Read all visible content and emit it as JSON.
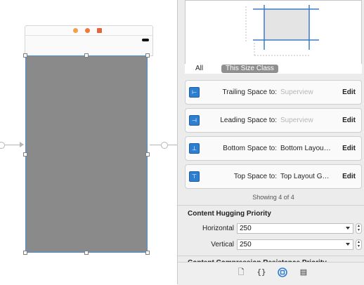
{
  "canvas": {
    "scene_dock_icons": [
      "view-controller-icon",
      "first-responder-icon",
      "exit-icon"
    ],
    "colors": {
      "view_fill": "#8a8a8a",
      "selection": "#4a90d9"
    }
  },
  "inspector": {
    "size_class_tabs": {
      "all": "All",
      "this_size_class": "This Size Class"
    },
    "constraints": [
      {
        "label": "Trailing Space to:",
        "value": "Superview",
        "value_muted": true,
        "edit": "Edit",
        "icon": "trailing-space-icon"
      },
      {
        "label": "Leading Space to:",
        "value": "Superview",
        "value_muted": true,
        "edit": "Edit",
        "icon": "leading-space-icon"
      },
      {
        "label": "Bottom Space to:",
        "value": "Bottom Layou…",
        "value_muted": false,
        "edit": "Edit",
        "icon": "bottom-space-icon"
      },
      {
        "label": "Top Space to:",
        "value": "Top Layout G…",
        "value_muted": false,
        "edit": "Edit",
        "icon": "top-space-icon"
      }
    ],
    "showing": "Showing 4 of 4",
    "content_hugging": {
      "title": "Content Hugging Priority",
      "horizontal_label": "Horizontal",
      "horizontal_value": "250",
      "vertical_label": "Vertical",
      "vertical_value": "250"
    },
    "next_section_title": "Content Compression Resistance Priority",
    "bottom_tabs": [
      "file-inspector-icon",
      "quick-help-icon",
      "identity-inspector-icon",
      "attributes-inspector-icon"
    ]
  }
}
